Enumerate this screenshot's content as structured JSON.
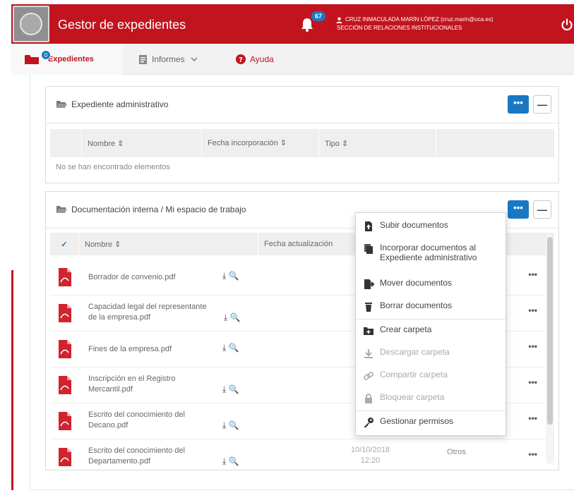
{
  "header": {
    "app_title": "Gestor de expedientes",
    "notifications_count": "67",
    "user_name": "CRUZ INMACULADA MARÍN LÓPEZ (cruz.marin@uca.es)",
    "user_department": "SECCIÓN DE RELACIONES INSTITUCIONALES",
    "brand_color": "#c1141f"
  },
  "nav": {
    "expedientes_label": "Expedientes",
    "expedientes_badge": "0",
    "informes_label": "Informes",
    "ayuda_label": "Ayuda"
  },
  "panel_admin": {
    "title": "Expediente administrativo",
    "more_label": "•••",
    "collapse_label": "—",
    "columns": [
      "Nombre ⇕",
      "Fecha incorporación ⇕",
      "Tipo ⇕"
    ],
    "empty_message": "No se han encontrado elementos"
  },
  "panel_internal": {
    "title": "Documentación interna / Mi espacio de trabajo",
    "more_label": "•••",
    "collapse_label": "—",
    "select_all": "✓",
    "columns": [
      "Nombre ⇕",
      "Fecha actualización"
    ],
    "rows": [
      {
        "name_line1": "Borrador de convenio.pdf",
        "name_line2": "",
        "menu": "•••"
      },
      {
        "name_line1": "Capacidad legal del representante",
        "name_line2": "de la empresa.pdf",
        "menu": "•••"
      },
      {
        "name_line1": "Fines de la empresa.pdf",
        "name_line2": "",
        "menu": "•••"
      },
      {
        "name_line1": "Inscripción en el Registro",
        "name_line2": "Mercantil.pdf",
        "menu": "•••"
      },
      {
        "name_line1": "Escrito del conocimiento del",
        "name_line2": "Decano.pdf",
        "menu": "•••"
      },
      {
        "name_line1": "Escrito del conocimiento del",
        "name_line2": "Departamento.pdf",
        "menu": "•••",
        "date_line1": "10/10/2018",
        "date_line2": "12:20",
        "type": "Otros"
      }
    ]
  },
  "dropdown": {
    "items": [
      {
        "label": "Subir documentos",
        "icon": "file-upload-icon",
        "disabled": false
      },
      {
        "label": "Incorporar documentos al Expediente administrativo",
        "icon": "files-icon",
        "disabled": false
      },
      {
        "label": "Mover documentos",
        "icon": "move-file-icon",
        "disabled": false
      },
      {
        "label": "Borrar documentos",
        "icon": "trash-icon",
        "disabled": false
      },
      {
        "label": "Crear carpeta",
        "icon": "folder-plus-icon",
        "disabled": false
      },
      {
        "label": "Descargar carpeta",
        "icon": "download-icon",
        "disabled": true
      },
      {
        "label": "Compartir carpeta",
        "icon": "link-icon",
        "disabled": true
      },
      {
        "label": "Bloquear carpeta",
        "icon": "lock-icon",
        "disabled": true
      },
      {
        "label": "Gestionar permisos",
        "icon": "key-icon",
        "disabled": false
      }
    ]
  }
}
